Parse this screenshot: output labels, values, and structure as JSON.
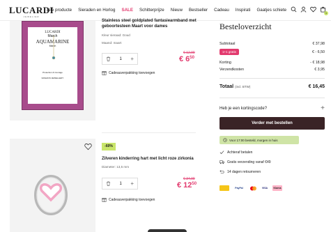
{
  "header": {
    "logo": "LUCARDI",
    "logo_sub": "JEWELIER",
    "nav": [
      "Alle producte",
      "Sieraden en Horlog",
      "SALE",
      "Schitterprijze",
      "Nieuw",
      "Bestseller",
      "Cadeau",
      "Inspirati",
      "Gaatjes schiete"
    ],
    "cart_count": "1"
  },
  "products": [
    {
      "title": "Stainless steel goldplated fantasiearmband met geboortesteen Maart voor dames",
      "color": "Kleur sieraad: Goud",
      "variant": "Maand: maart",
      "quantity": "1",
      "old_price": "€ 12,99",
      "new_price_main": "€ 6",
      "new_price_cents": "50",
      "gift": "Cadeauverpakking toevoegen",
      "card_brand": "LUCARDI",
      "card_sub": "March",
      "card_stone": "AQUAMARINE",
      "card_stone_sub": "March",
      "card_text": "Protection & Courage",
      "card_footer": "FASHION JEWELLERY"
    },
    {
      "badge": "-60%",
      "title": "Zilveren kinderring hart met licht roze zirkonia",
      "variant": "Diameter: 13,5 mm",
      "quantity": "1",
      "old_price": "€ 34,99",
      "new_price_main": "€ 12",
      "new_price_cents": "50",
      "gift": "Cadeauverpakking toevoegen"
    }
  ],
  "summary": {
    "title": "Besteloverzicht",
    "subtotal_label": "Subtotaal",
    "subtotal_value": "€ 37,98",
    "gratis_label": "1+1 gratis",
    "gratis_value": "€ - 6,50",
    "discount_label": "Korting",
    "discount_value": "- € 18,98",
    "shipping_label": "Verzendkosten",
    "shipping_value": "€ 3,95",
    "total_label": "Totaal",
    "total_suffix": "(incl. BTW)",
    "total_value": "€ 16,45",
    "coupon_label": "Heb je een kortingscode?",
    "checkout_label": "Verder met bestellen",
    "delivery_text": "Voor 17:00 besteld, morgen in huis",
    "usps": [
      "Achteraf betalen",
      "Gratis verzending vanaf €49",
      "14 dagen retourneren"
    ],
    "payments": [
      "iDEAL",
      "PayPal",
      "Mastercard",
      "VISA",
      "Klarna"
    ]
  },
  "colors": {
    "accent": "#e23a6e",
    "checkout": "#3a2326",
    "badge": "#c9e56b",
    "delivery": "#cfe4a6"
  }
}
